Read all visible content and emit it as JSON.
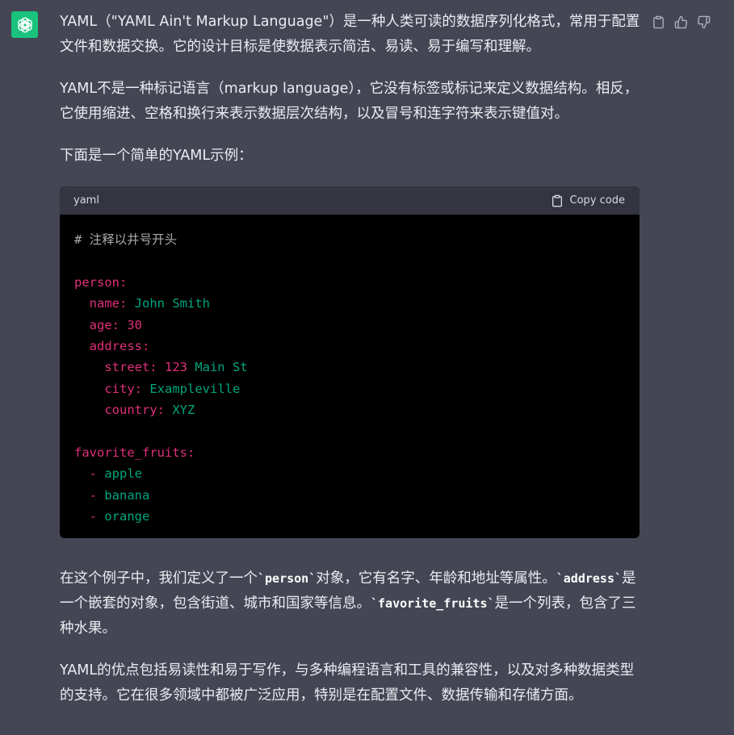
{
  "message": {
    "avatar_icon": "openai-logo-icon",
    "actions": [
      {
        "name": "copy-message",
        "icon": "clipboard-icon"
      },
      {
        "name": "thumbs-up",
        "icon": "thumbs-up-icon"
      },
      {
        "name": "thumbs-down",
        "icon": "thumbs-down-icon"
      }
    ],
    "paragraph1": "YAML（\"YAML Ain't Markup Language\"）是一种人类可读的数据序列化格式，常用于配置文件和数据交换。它的设计目标是使数据表示简洁、易读、易于编写和理解。",
    "paragraph2": "YAML不是一种标记语言（markup language），它没有标签或标记来定义数据结构。相反，它使用缩进、空格和换行来表示数据层次结构，以及冒号和连字符来表示键值对。",
    "paragraph3": "下面是一个简单的YAML示例：",
    "code_block": {
      "language": "yaml",
      "copy_label": "Copy code",
      "lines": [
        [
          {
            "t": "# 注释以井号开头",
            "c": "comment"
          }
        ],
        [],
        [
          {
            "t": "person:",
            "c": "key"
          }
        ],
        [
          {
            "t": "  name:",
            "c": "key"
          },
          {
            "t": " John Smith",
            "c": "val"
          }
        ],
        [
          {
            "t": "  age:",
            "c": "key"
          },
          {
            "t": " 30",
            "c": "num"
          }
        ],
        [
          {
            "t": "  address:",
            "c": "key"
          }
        ],
        [
          {
            "t": "    street:",
            "c": "key"
          },
          {
            "t": " 123",
            "c": "num"
          },
          {
            "t": " Main St",
            "c": "val"
          }
        ],
        [
          {
            "t": "    city:",
            "c": "key"
          },
          {
            "t": " Exampleville",
            "c": "val"
          }
        ],
        [
          {
            "t": "    country:",
            "c": "key"
          },
          {
            "t": " XYZ",
            "c": "val"
          }
        ],
        [],
        [
          {
            "t": "favorite_fruits:",
            "c": "key"
          }
        ],
        [
          {
            "t": "  -",
            "c": "dash"
          },
          {
            "t": " apple",
            "c": "val"
          }
        ],
        [
          {
            "t": "  -",
            "c": "dash"
          },
          {
            "t": " banana",
            "c": "val"
          }
        ],
        [
          {
            "t": "  -",
            "c": "dash"
          },
          {
            "t": " orange",
            "c": "val"
          }
        ]
      ]
    },
    "paragraph4": [
      {
        "t": "在这个例子中，我们定义了一个"
      },
      {
        "code": "`person`"
      },
      {
        "t": "对象，它有名字、年龄和地址等属性。"
      },
      {
        "code": "`address`"
      },
      {
        "t": "是一个嵌套的对象，包含街道、城市和国家等信息。"
      },
      {
        "code": "`favorite_fruits`"
      },
      {
        "t": "是一个列表，包含了三种水果。"
      }
    ],
    "paragraph5": "YAML的优点包括易读性和易于写作，与多种编程语言和工具的兼容性，以及对多种数据类型的支持。它在很多领域中都被广泛应用，特别是在配置文件、数据传输和存储方面。"
  },
  "colors": {
    "background": "#444654",
    "code_header": "#343541",
    "code_background": "#000000",
    "avatar": "#19c37d",
    "syntax_key": "#df3079",
    "syntax_value": "#00a67d",
    "syntax_comment": "#aaaaaa"
  }
}
